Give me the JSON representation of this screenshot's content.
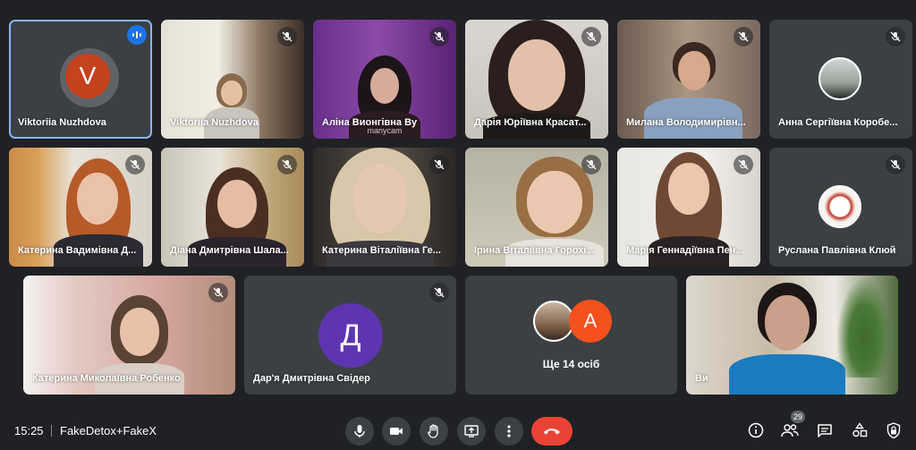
{
  "tiles": [
    {
      "name": "Viktoriia Nuzhdova",
      "avatar_letter": "V",
      "avatar_color": "#c5421f",
      "speaking": true
    },
    {
      "name": "Viktoriia Nuzhdova",
      "muted": true
    },
    {
      "name": "Аліна Вионгівна Ву",
      "muted": true,
      "watermark": "manycam"
    },
    {
      "name": "Дарія Юріївна Красат...",
      "muted": true
    },
    {
      "name": "Милана Володимирівн...",
      "muted": true
    },
    {
      "name": "Анна Сергіївна Коробе...",
      "muted": true
    },
    {
      "name": "Катерина Вадимівна Д...",
      "muted": true
    },
    {
      "name": "Діана Дмитрівна Шала...",
      "muted": true
    },
    {
      "name": "Катерина Віталіївна Ге...",
      "muted": true
    },
    {
      "name": "Ірина Віталіївна Горохі...",
      "muted": true
    },
    {
      "name": "Марія Геннадіївна Пен...",
      "muted": true
    },
    {
      "name": "Руслана Павлівна Клюй",
      "muted": true
    },
    {
      "name": "Катерина Миколаївна Робенко",
      "muted": true
    },
    {
      "name": "Дар'я Дмитрівна Свідер",
      "avatar_letter": "Д",
      "avatar_color": "#5e35b1",
      "muted": true
    },
    {
      "name": "Ще 14 осіб",
      "avatar_letter": "A",
      "avatar_color": "#f4511e"
    },
    {
      "name": "Ви"
    }
  ],
  "bottom_bar": {
    "time": "15:25",
    "separator": "|",
    "meeting_name": "FakeDetox+FakeX",
    "controls": [
      "mic-icon",
      "camera-icon",
      "raise-hand-icon",
      "present-screen-icon",
      "more-options-icon",
      "end-call-icon"
    ],
    "right_icons": [
      "info-icon",
      "people-icon",
      "chat-icon",
      "activities-icon",
      "host-controls-icon"
    ],
    "participant_count": "29"
  },
  "colors": {
    "background": "#202124",
    "tile": "#3c4043",
    "active_border": "#8ab4f8",
    "end_call": "#ea4335",
    "speaking": "#1a73e8"
  }
}
